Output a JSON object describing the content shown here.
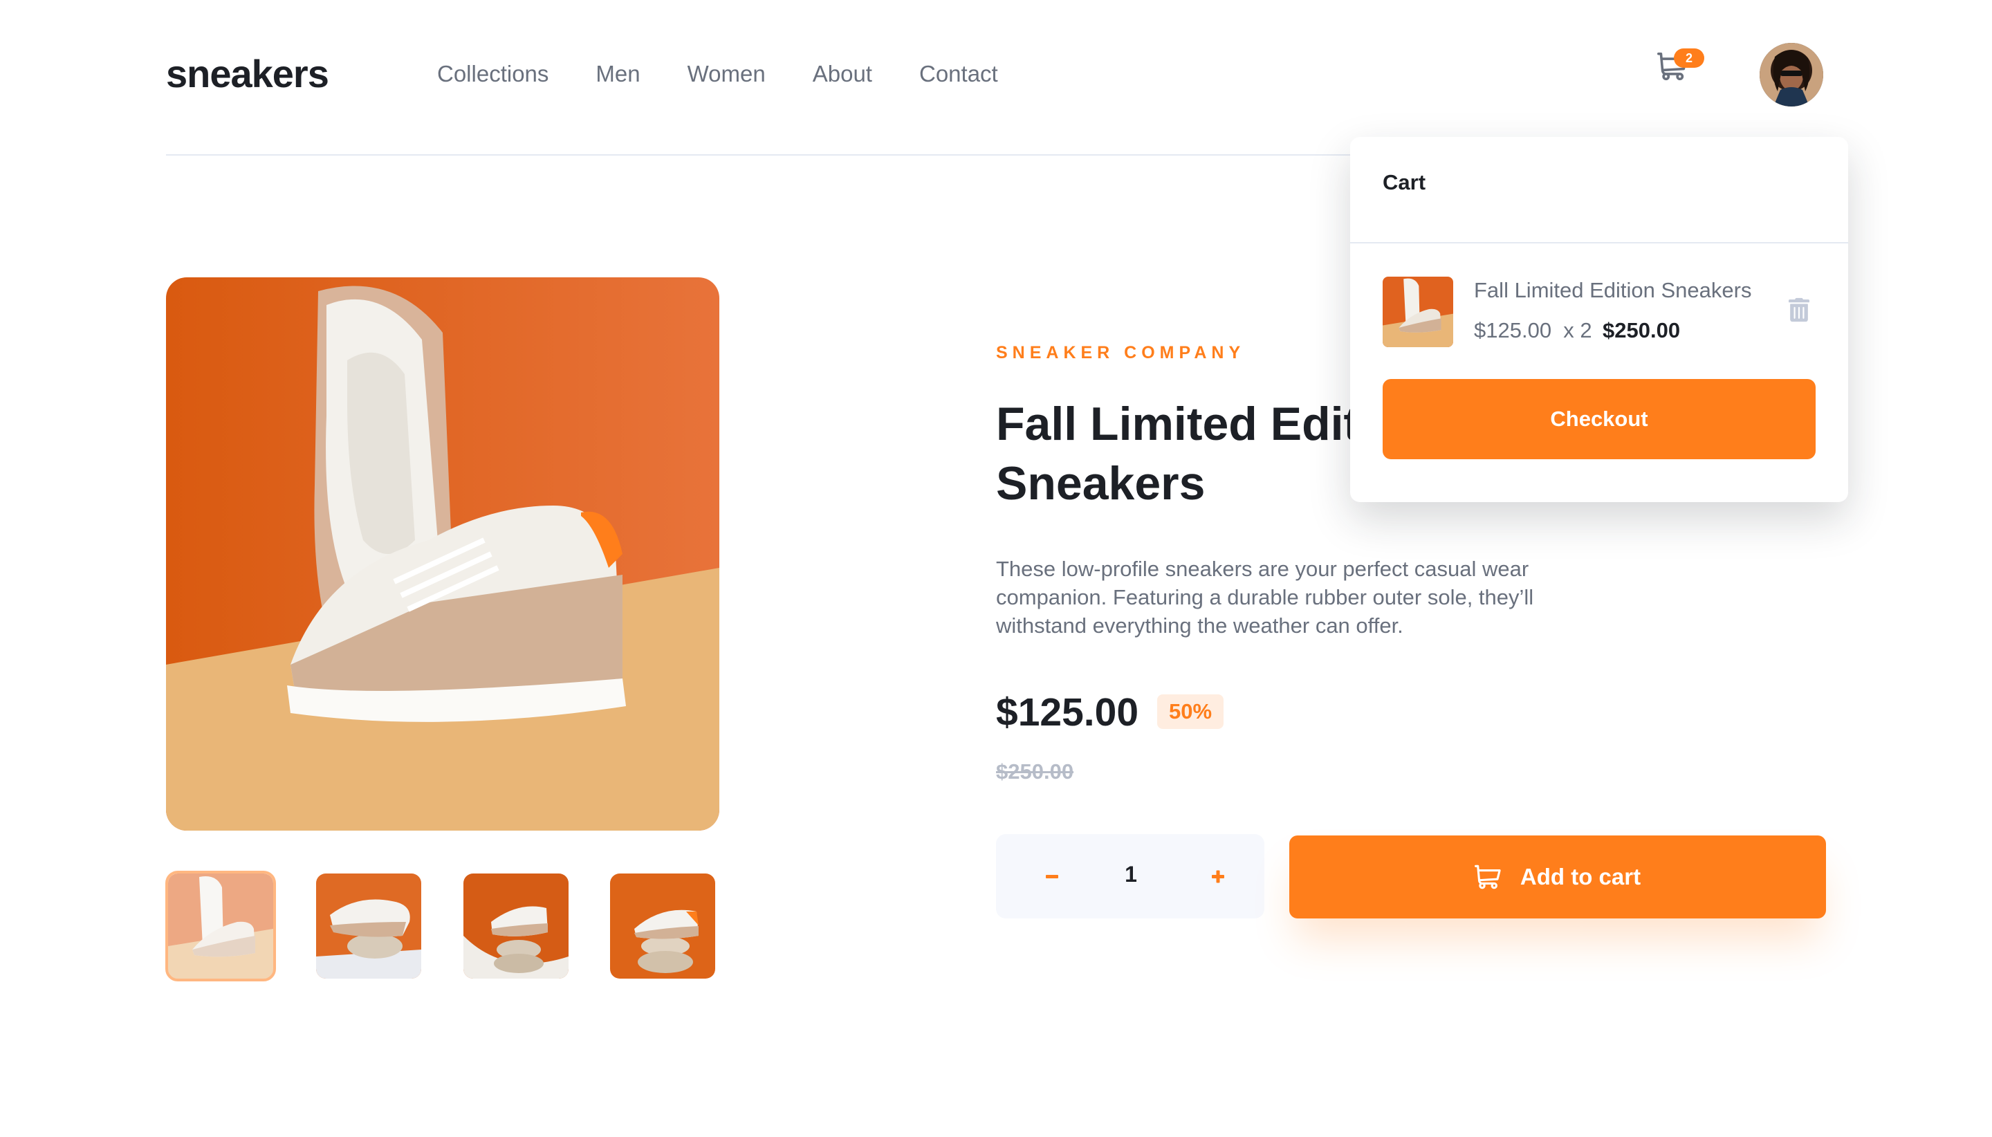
{
  "header": {
    "logo": "sneakers",
    "nav": [
      "Collections",
      "Men",
      "Women",
      "About",
      "Contact"
    ],
    "cart_count": "2"
  },
  "product": {
    "company": "SNEAKER COMPANY",
    "title": "Fall Limited Edition Sneakers",
    "description": "These low-profile sneakers are your perfect casual wear companion. Featuring a durable rubber outer sole, they’ll withstand everything the weather can offer.",
    "price": "$125.00",
    "discount": "50%",
    "original_price": "$250.00",
    "quantity": "1",
    "add_to_cart_label": "Add to cart"
  },
  "gallery": {
    "selected_index": 1,
    "thumbnail_count": 4
  },
  "cart": {
    "title": "Cart",
    "item_name": "Fall Limited Edition Sneakers",
    "item_calc": "$125.00  x 2",
    "item_total": "$250.00",
    "checkout_label": "Checkout"
  },
  "colors": {
    "accent": "#ff7e1b",
    "accent_light": "#ffede0",
    "text_dark": "#1d2026",
    "text_gray": "#69707d"
  }
}
